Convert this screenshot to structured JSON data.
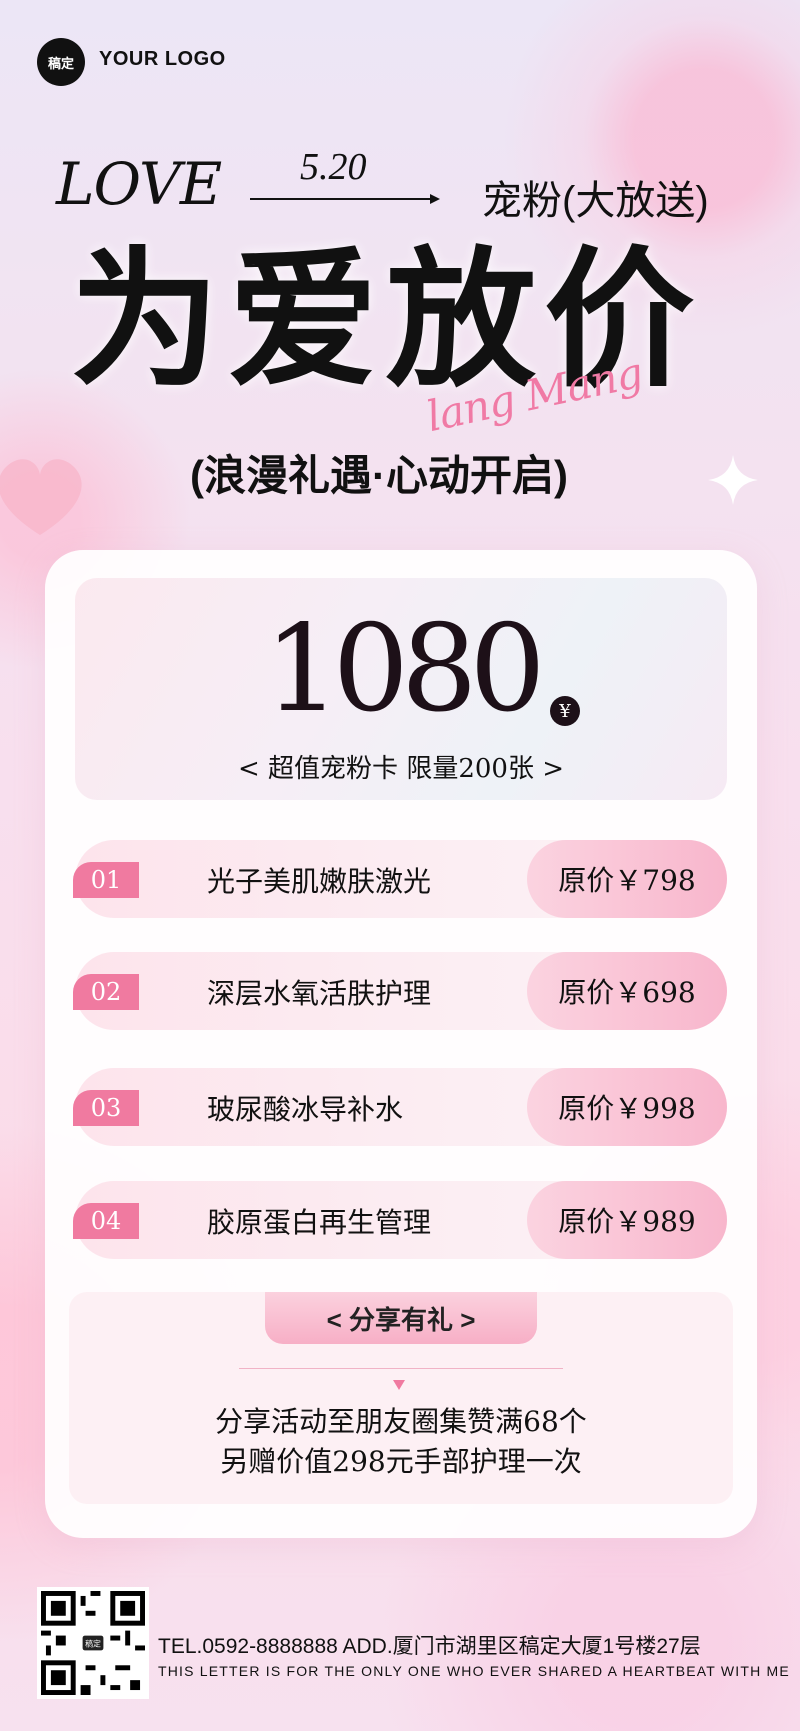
{
  "brand": {
    "badge": "稿定",
    "logo_text": "YOUR LOGO"
  },
  "header": {
    "love": "LOVE",
    "date": "5.20",
    "tagline": "宠粉(大放送)",
    "headline": "为爱放价",
    "script": "lang Mang",
    "subtitle": "(浪漫礼遇·心动开启)"
  },
  "price_card": {
    "price": "1080",
    "currency": "¥",
    "desc": "< 超值宠粉卡 限量200张 >"
  },
  "items": [
    {
      "num": "01",
      "name": "光子美肌嫩肤激光",
      "orig": "原价￥798"
    },
    {
      "num": "02",
      "name": "深层水氧活肤护理",
      "orig": "原价￥698"
    },
    {
      "num": "03",
      "name": "玻尿酸冰导补水",
      "orig": "原价￥998"
    },
    {
      "num": "04",
      "name": "胶原蛋白再生管理",
      "orig": "原价￥989"
    }
  ],
  "share": {
    "title": "< 分享有礼 >",
    "line1": "分享活动至朋友圈集赞满68个",
    "line2": "另赠价值298元手部护理一次"
  },
  "footer": {
    "qr_badge": "稿定",
    "contact": "TEL.0592-8888888  ADD.厦门市湖里区稿定大厦1号楼27层",
    "slogan": "THIS LETTER IS FOR THE ONLY ONE WHO EVER SHARED A HEARTBEAT WITH ME"
  },
  "colors": {
    "accent": "#f07aa0",
    "text": "#111111"
  }
}
